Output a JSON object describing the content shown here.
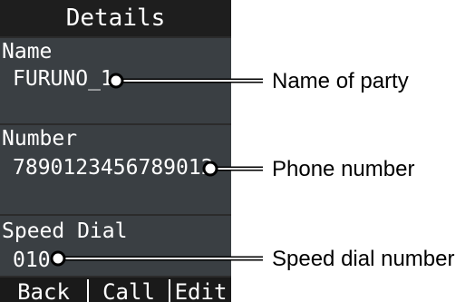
{
  "screen": {
    "title": "Details",
    "fields": {
      "name": {
        "label": "Name",
        "value": "FURUNO_1"
      },
      "number": {
        "label": "Number",
        "value": "7890123456789012"
      },
      "speed_dial": {
        "label": "Speed Dial",
        "value": "010"
      }
    },
    "softkeys": {
      "back": "Back",
      "call": "Call",
      "edit": "Edit"
    }
  },
  "callouts": {
    "name": "Name of party",
    "number": "Phone number",
    "speed_dial": "Speed dial number"
  }
}
